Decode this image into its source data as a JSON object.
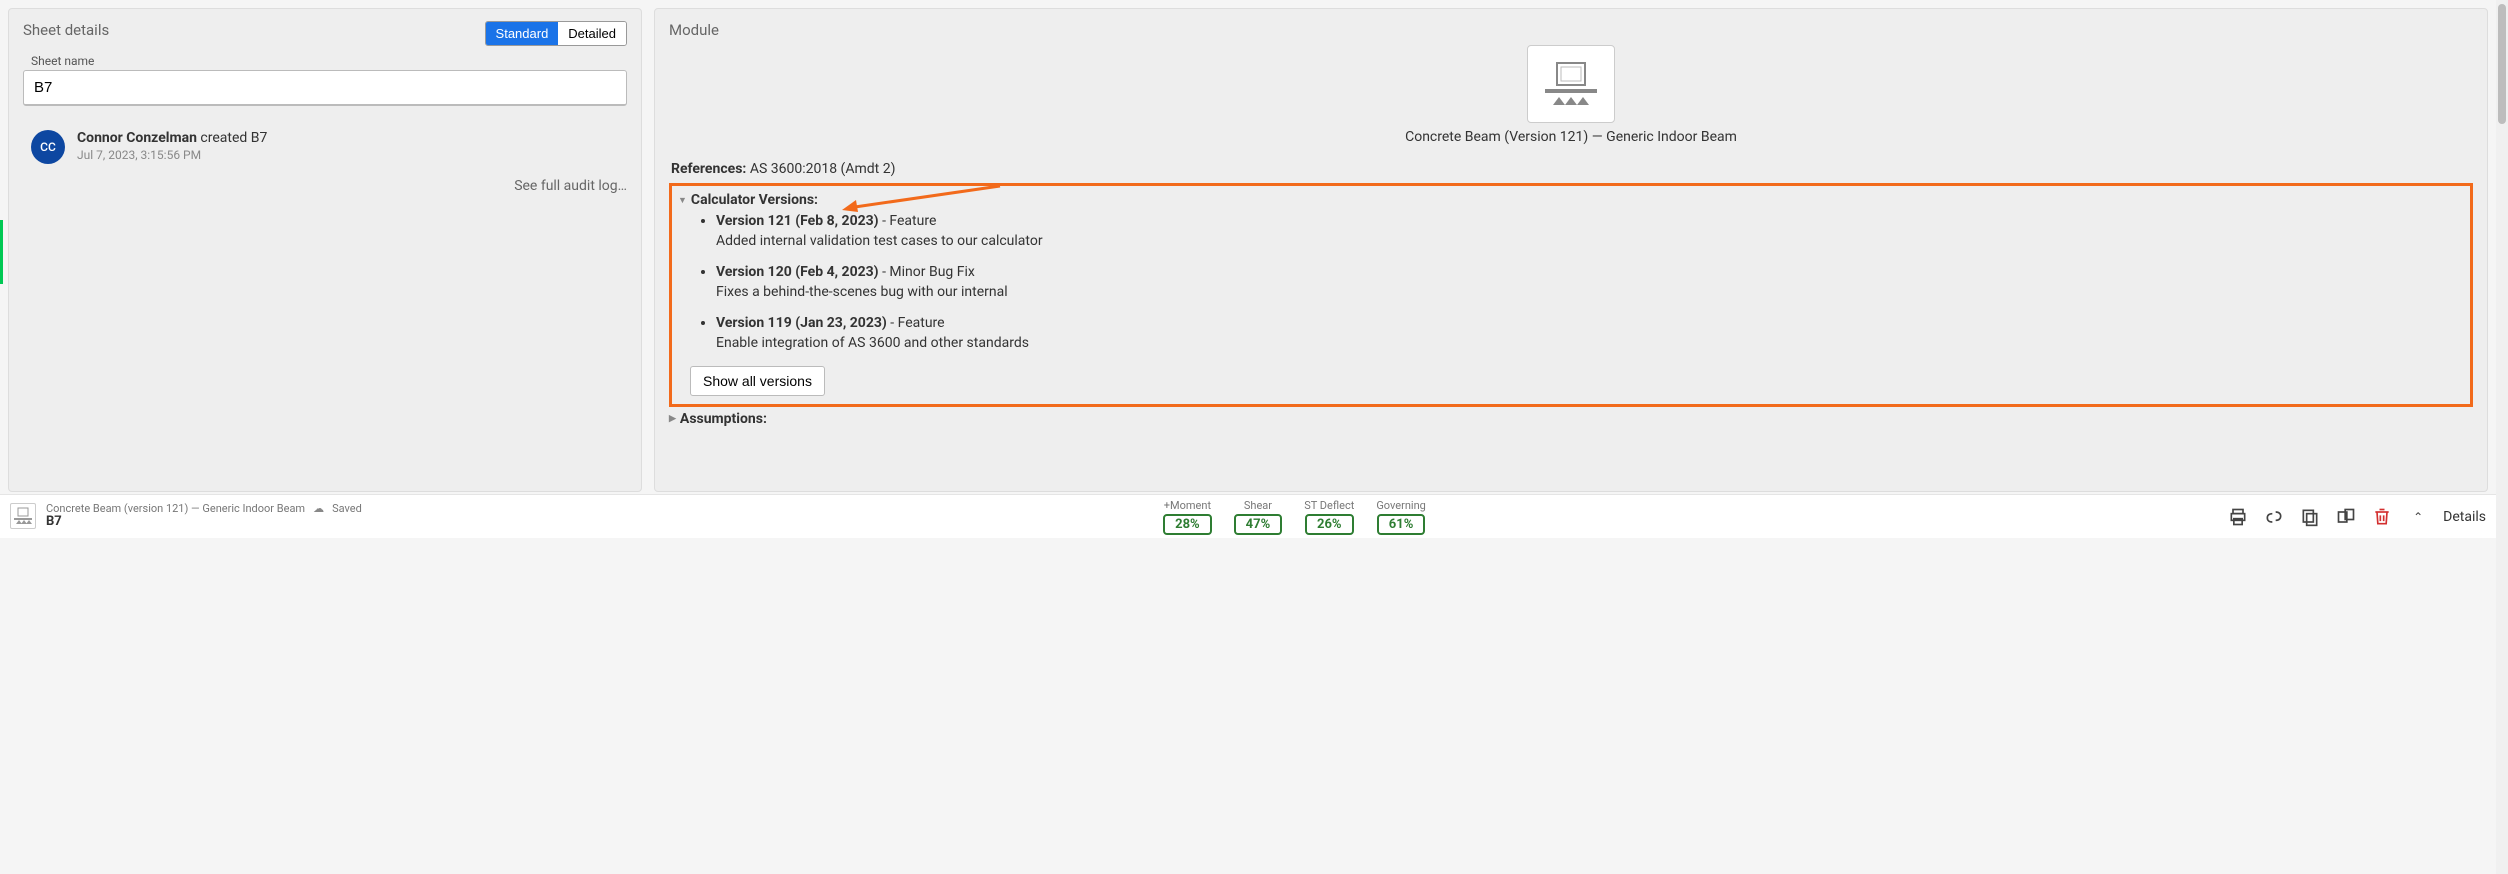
{
  "left": {
    "title": "Sheet details",
    "toggle": {
      "standard": "Standard",
      "detailed": "Detailed"
    },
    "sheetNameLabel": "Sheet name",
    "sheetNameValue": "B7",
    "audit": {
      "initials": "CC",
      "who": "Connor Conzelman",
      "didWhatPrefix": " created ",
      "didWhat": "B7",
      "when": "Jul 7, 2023, 3:15:56 PM"
    },
    "auditLink": "See full audit log…"
  },
  "right": {
    "title": "Module",
    "moduleTitle": "Concrete Beam (Version 121) — Generic Indoor Beam",
    "referencesLabel": "References:",
    "referencesValue": "AS 3600:2018 (Amdt 2)",
    "calcVersionsLabel": "Calculator Versions:",
    "versions": [
      {
        "header": "Version 121 (Feb 8, 2023)",
        "tag": " - Feature",
        "body": "Added internal validation test cases to our calculator"
      },
      {
        "header": "Version 120 (Feb 4, 2023)",
        "tag": " - Minor Bug Fix",
        "body": "Fixes a behind-the-scenes bug with our internal"
      },
      {
        "header": "Version 119 (Jan 23, 2023)",
        "tag": " - Feature",
        "body": "Enable integration of AS 3600 and other standards"
      }
    ],
    "showAll": "Show all versions",
    "assumptionsLabel": "Assumptions:"
  },
  "footer": {
    "descTop": "Concrete Beam (version 121) — Generic Indoor Beam",
    "saved": "Saved",
    "descBot": "B7",
    "stats": [
      {
        "label": "+Moment",
        "value": "28%"
      },
      {
        "label": "Shear",
        "value": "47%"
      },
      {
        "label": "ST Deflect",
        "value": "26%"
      },
      {
        "label": "Governing",
        "value": "61%"
      }
    ],
    "details": "Details"
  }
}
